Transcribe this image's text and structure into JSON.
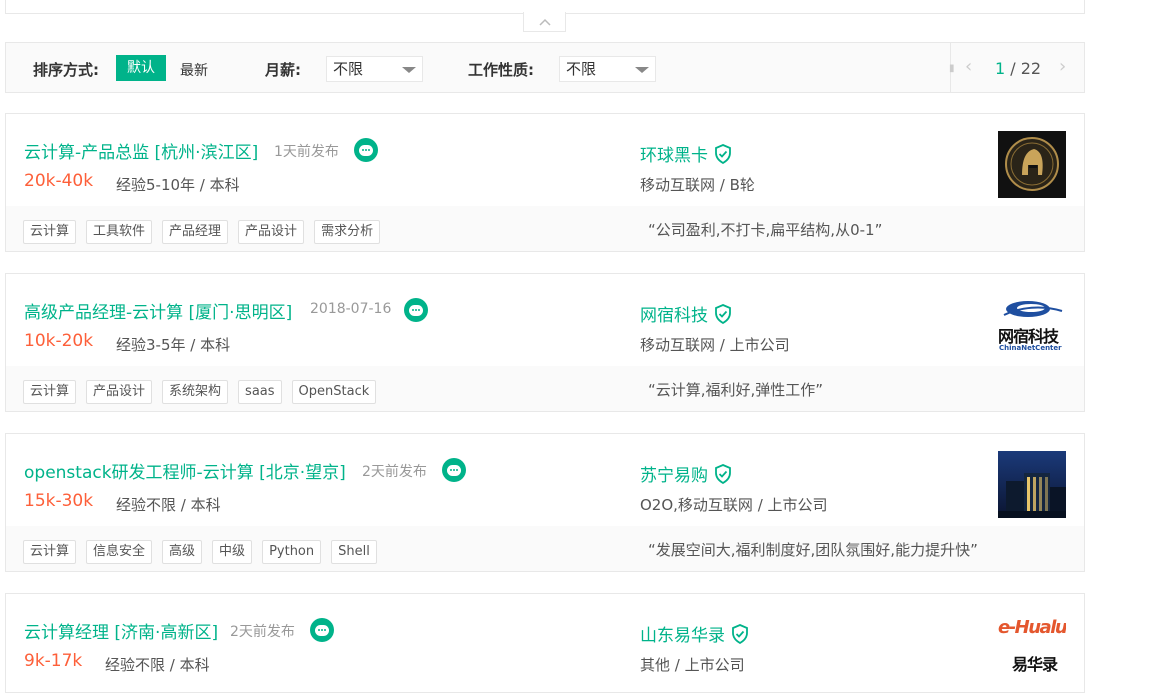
{
  "filter": {
    "sort_label": "排序方式:",
    "sort_default": "默认",
    "sort_newest": "最新",
    "salary_label": "月薪:",
    "salary_value": "不限",
    "nature_label": "工作性质:",
    "nature_value": "不限",
    "page_current": "1",
    "page_sep": " / ",
    "page_total": "22",
    "prev_glyph": "‹",
    "next_glyph": "›"
  },
  "jobs": [
    {
      "title": "云计算-产品总监 [杭州·滨江区]",
      "time": "1天前发布",
      "salary": "20k-40k",
      "requirement": "经验5-10年 / 本科",
      "company": "环球黑卡",
      "industry": "移动互联网 / B轮",
      "tags": [
        "云计算",
        "工具软件",
        "产品经理",
        "产品设计",
        "需求分析"
      ],
      "quote": "“公司盈利,不打卡,扁平结构,从0-1”",
      "logo_icon": "helmet-logo-icon"
    },
    {
      "title": "高级产品经理-云计算 [厦门·思明区]",
      "time": "2018-07-16",
      "salary": "10k-20k",
      "requirement": "经验3-5年 / 本科",
      "company": "网宿科技",
      "industry": "移动互联网 / 上市公司",
      "tags": [
        "云计算",
        "产品设计",
        "系统架构",
        "saas",
        "OpenStack"
      ],
      "quote": "“云计算,福利好,弹性工作”",
      "logo_text": "网宿科技",
      "logo_sub": "ChinaNetCenter"
    },
    {
      "title": "openstack研发工程师-云计算 [北京·望京]",
      "time": "2天前发布",
      "salary": "15k-30k",
      "requirement": "经验不限 / 本科",
      "company": "苏宁易购",
      "industry": "O2O,移动互联网 / 上市公司",
      "tags": [
        "云计算",
        "信息安全",
        "高级",
        "中级",
        "Python",
        "Shell"
      ],
      "quote": "“发展空间大,福利制度好,团队氛围好,能力提升快”",
      "logo_icon": "building-photo-icon"
    },
    {
      "title": "云计算经理 [济南·高新区]",
      "time": "2天前发布",
      "salary": "9k-17k",
      "requirement": "经验不限 / 本科",
      "company": "山东易华录",
      "industry": "其他 / 上市公司",
      "logo_text": "e-Hualu",
      "logo_sub": "易华录"
    }
  ],
  "colors": {
    "accent": "#00b38a",
    "salary": "#fd5f39"
  }
}
